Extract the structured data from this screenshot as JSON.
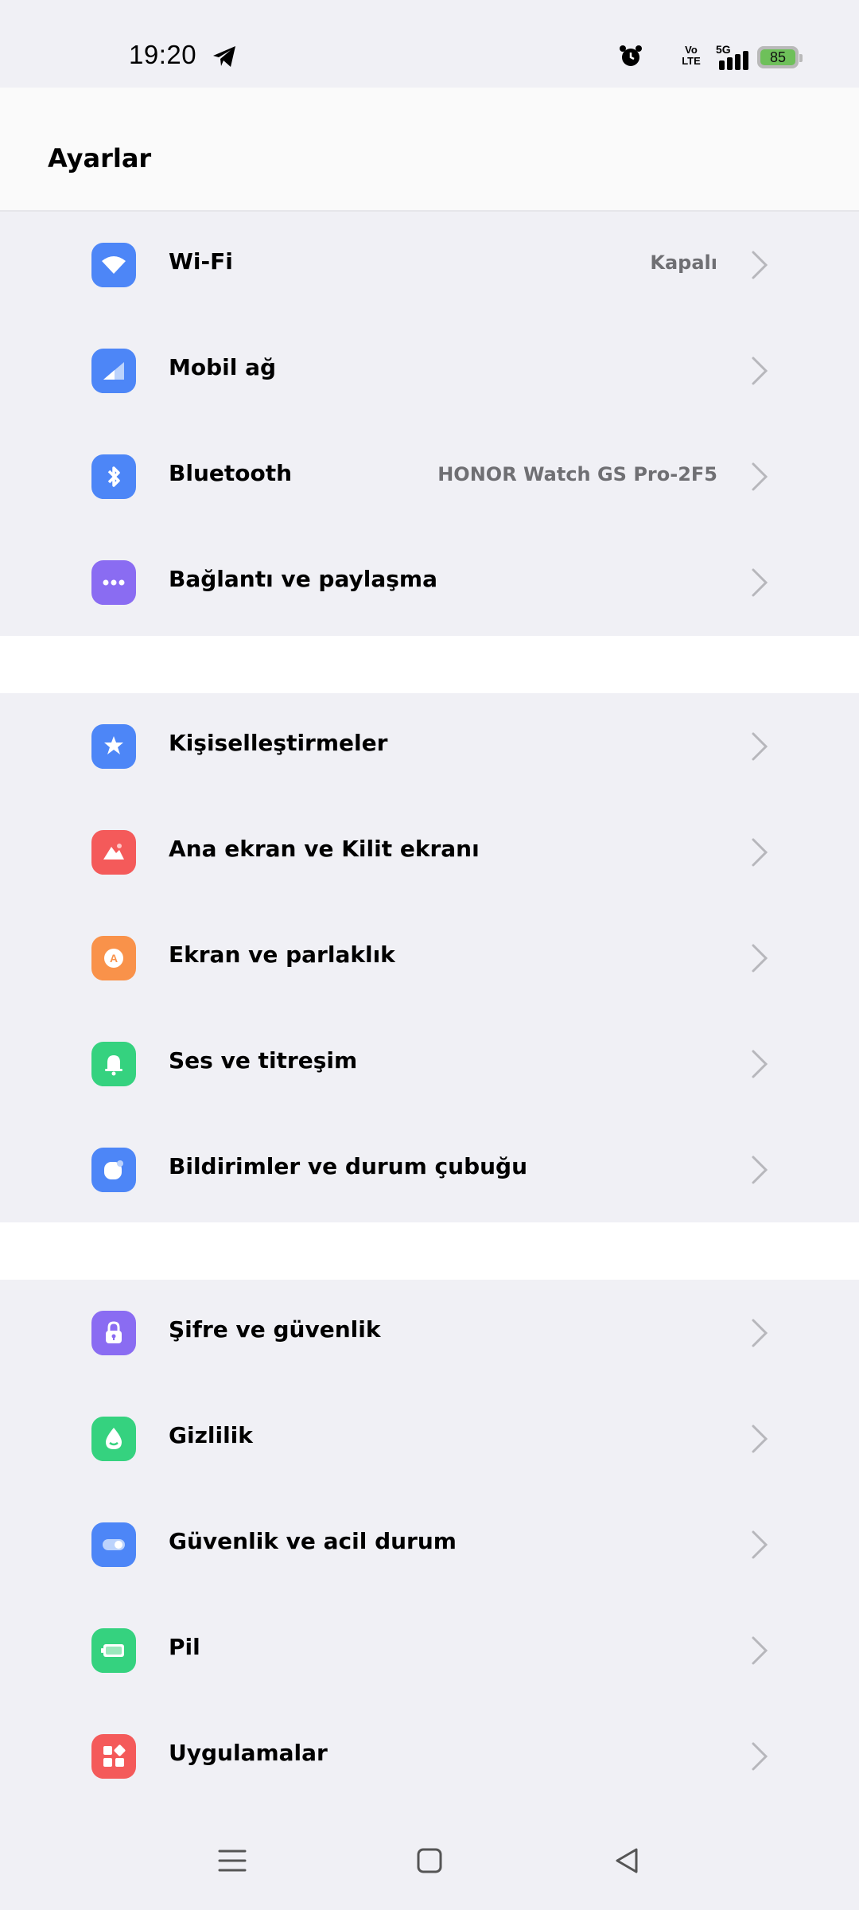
{
  "status_bar": {
    "time": "19:20",
    "volte_top": "Vo",
    "volte_bottom": "LTE",
    "network": "5G",
    "battery": "85"
  },
  "header": {
    "title": "Ayarlar"
  },
  "groups": [
    {
      "items": [
        {
          "label": "Wi-Fi",
          "value": "Kapalı",
          "icon": "wifi-icon",
          "color": "#4d86f7"
        },
        {
          "label": "Mobil ağ",
          "value": "",
          "icon": "mobile-network-icon",
          "color": "#4d86f7"
        },
        {
          "label": "Bluetooth",
          "value": "HONOR Watch GS Pro-2F5",
          "icon": "bluetooth-icon",
          "color": "#4d86f7"
        },
        {
          "label": "Bağlantı ve paylaşma",
          "value": "",
          "icon": "connection-sharing-icon",
          "color": "#8a6cf2"
        }
      ]
    },
    {
      "items": [
        {
          "label": "Kişiselleştirmeler",
          "icon": "personalization-icon",
          "color": "#4d86f7"
        },
        {
          "label": "Ana ekran ve Kilit ekranı",
          "icon": "home-lock-screen-icon",
          "color": "#f45a5a"
        },
        {
          "label": "Ekran ve parlaklık",
          "icon": "display-brightness-icon",
          "color": "#f9924a"
        },
        {
          "label": "Ses ve titreşim",
          "icon": "sound-bell-icon",
          "color": "#35d27f"
        },
        {
          "label": "Bildirimler ve durum çubuğu",
          "icon": "notifications-icon",
          "color": "#4d86f7"
        }
      ]
    },
    {
      "items": [
        {
          "label": "Şifre ve güvenlik",
          "icon": "lock-icon",
          "color": "#8a6cf2"
        },
        {
          "label": "Gizlilik",
          "icon": "privacy-drop-icon",
          "color": "#35d27f"
        },
        {
          "label": "Güvenlik ve acil durum",
          "icon": "safety-toggle-icon",
          "color": "#4d86f7"
        },
        {
          "label": "Pil",
          "icon": "battery-icon",
          "color": "#35d27f"
        },
        {
          "label": "Uygulamalar",
          "icon": "apps-icon",
          "color": "#f45a5a"
        }
      ]
    }
  ],
  "colors": {
    "background": "#f0f0f5",
    "chevron": "#b7b7bc",
    "value_text": "#6f6f73"
  }
}
